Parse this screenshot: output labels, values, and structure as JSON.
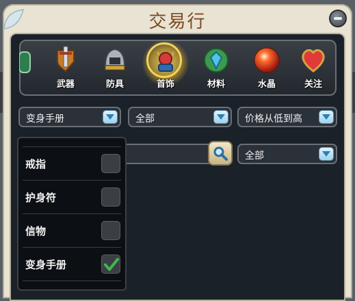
{
  "window": {
    "title": "交易行"
  },
  "categories": [
    {
      "label": "武器",
      "icon": "sword-shield-icon"
    },
    {
      "label": "防具",
      "icon": "helmet-icon"
    },
    {
      "label": "首饰",
      "icon": "amulet-icon",
      "active": true
    },
    {
      "label": "材料",
      "icon": "gem-material-icon"
    },
    {
      "label": "水晶",
      "icon": "crystal-orb-icon"
    },
    {
      "label": "关注",
      "icon": "heart-icon"
    }
  ],
  "filters": {
    "type_select": "变身手册",
    "sub_select": "全部",
    "sort_select": "价格从低到高",
    "quality_select": "全部",
    "search_placeholder": ""
  },
  "type_options": [
    {
      "label": "戒指",
      "checked": false
    },
    {
      "label": "护身符",
      "checked": false
    },
    {
      "label": "信物",
      "checked": false
    },
    {
      "label": "变身手册",
      "checked": true
    }
  ],
  "colors": {
    "accent": "#f4d35b",
    "title": "#7b4a24",
    "panel": "#1a2129"
  }
}
